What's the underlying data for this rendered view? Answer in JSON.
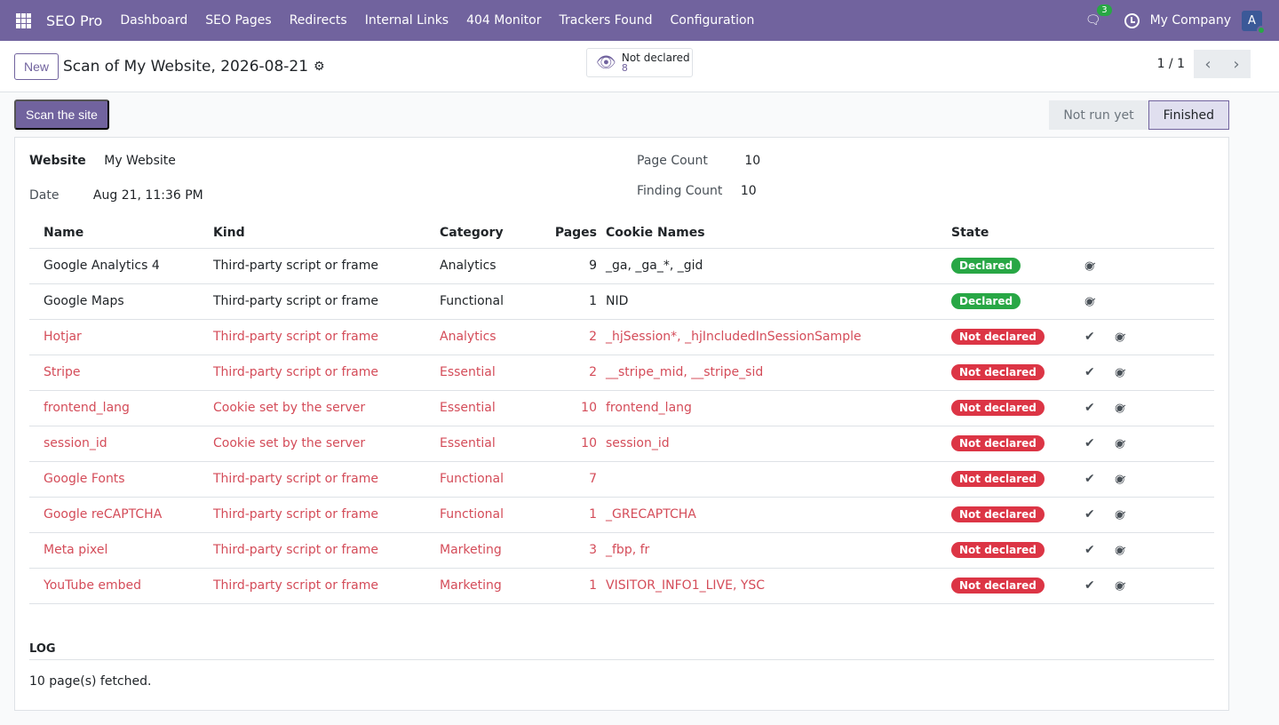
{
  "topbar": {
    "brand": "SEO Pro",
    "menu": [
      "Dashboard",
      "SEO Pages",
      "Redirects",
      "Internal Links",
      "404 Monitor",
      "Trackers Found",
      "Configuration"
    ],
    "chat_count": "3",
    "company": "My Company",
    "avatar": "A"
  },
  "control": {
    "new_label": "New",
    "title": "Scan of My Website, 2026-08-21",
    "smart_label": "Not declared",
    "smart_value": "8",
    "pager": "1 / 1"
  },
  "actions": {
    "scan_label": "Scan the site",
    "status_steps": [
      "Not run yet",
      "Finished"
    ]
  },
  "form": {
    "website_label": "Website",
    "website": "My Website",
    "date_label": "Date",
    "date": "Aug 21, 11:36 PM",
    "page_count_label": "Page Count",
    "page_count": "10",
    "finding_count_label": "Finding Count",
    "finding_count": "10"
  },
  "table": {
    "headers": [
      "Name",
      "Kind",
      "Category",
      "Pages",
      "Cookie Names",
      "State"
    ],
    "rows": [
      {
        "name": "Google Analytics 4",
        "kind": "Third-party script or frame",
        "category": "Analytics",
        "pages": "9",
        "cookies": "_ga, _ga_*, _gid",
        "state": "Declared"
      },
      {
        "name": "Google Maps",
        "kind": "Third-party script or frame",
        "category": "Functional",
        "pages": "1",
        "cookies": "NID",
        "state": "Declared"
      },
      {
        "name": "Hotjar",
        "kind": "Third-party script or frame",
        "category": "Analytics",
        "pages": "2",
        "cookies": "_hjSession*, _hjIncludedInSessionSample",
        "state": "Not declared"
      },
      {
        "name": "Stripe",
        "kind": "Third-party script or frame",
        "category": "Essential",
        "pages": "2",
        "cookies": "__stripe_mid, __stripe_sid",
        "state": "Not declared"
      },
      {
        "name": "frontend_lang",
        "kind": "Cookie set by the server",
        "category": "Essential",
        "pages": "10",
        "cookies": "frontend_lang",
        "state": "Not declared"
      },
      {
        "name": "session_id",
        "kind": "Cookie set by the server",
        "category": "Essential",
        "pages": "10",
        "cookies": "session_id",
        "state": "Not declared"
      },
      {
        "name": "Google Fonts",
        "kind": "Third-party script or frame",
        "category": "Functional",
        "pages": "7",
        "cookies": "",
        "state": "Not declared"
      },
      {
        "name": "Google reCAPTCHA",
        "kind": "Third-party script or frame",
        "category": "Functional",
        "pages": "1",
        "cookies": "_GRECAPTCHA",
        "state": "Not declared"
      },
      {
        "name": "Meta pixel",
        "kind": "Third-party script or frame",
        "category": "Marketing",
        "pages": "3",
        "cookies": "_fbp, fr",
        "state": "Not declared"
      },
      {
        "name": "YouTube embed",
        "kind": "Third-party script or frame",
        "category": "Marketing",
        "pages": "1",
        "cookies": "VISITOR_INFO1_LIVE, YSC",
        "state": "Not declared"
      }
    ]
  },
  "log": {
    "title": "LOG",
    "body": "10 page(s) fetched."
  }
}
